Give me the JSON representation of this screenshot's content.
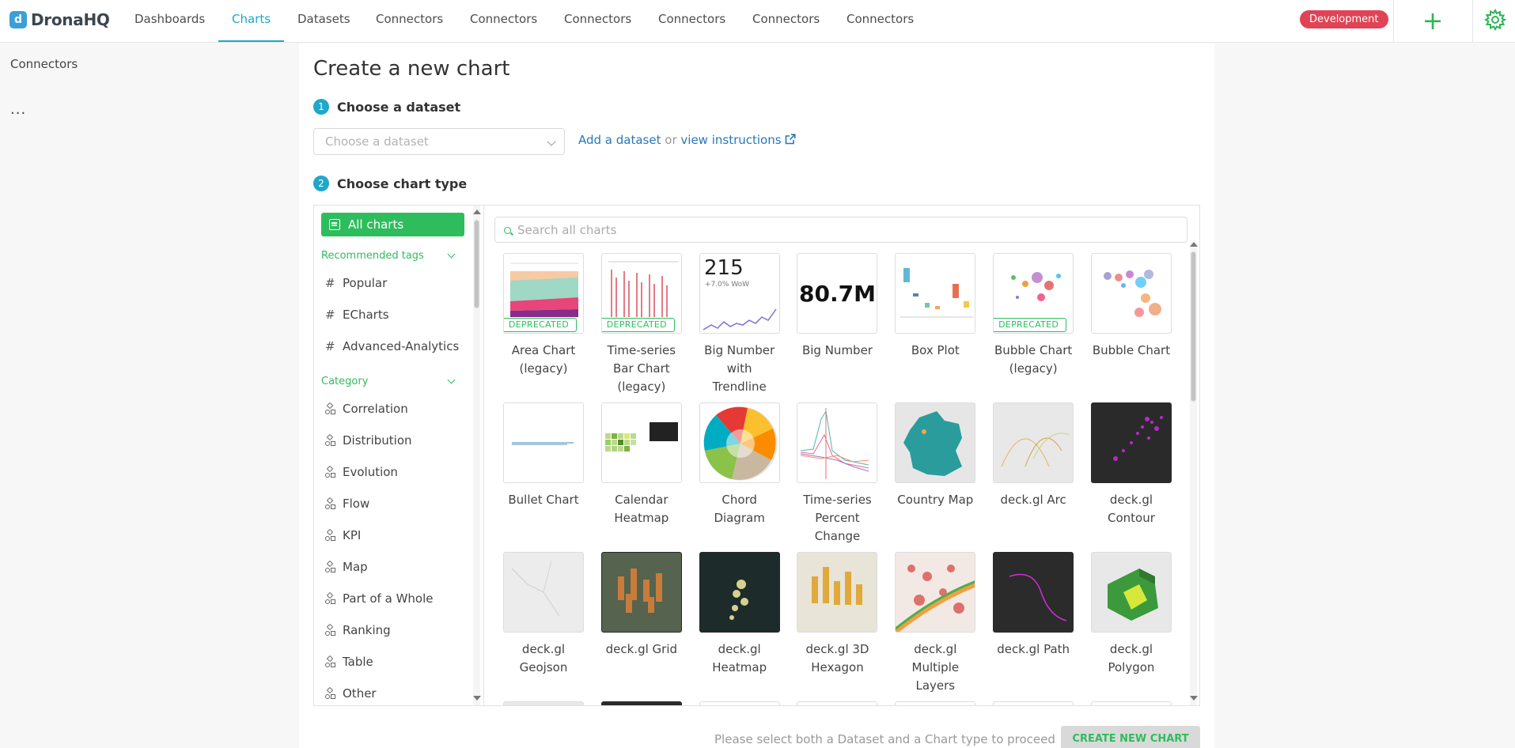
{
  "app": {
    "logo_text": "DronaHQ"
  },
  "nav": {
    "items": [
      {
        "label": "Dashboards"
      },
      {
        "label": "Charts"
      },
      {
        "label": "Datasets"
      },
      {
        "label": "Connectors"
      },
      {
        "label": "Connectors"
      },
      {
        "label": "Connectors"
      },
      {
        "label": "Connectors"
      },
      {
        "label": "Connectors"
      },
      {
        "label": "Connectors"
      }
    ],
    "active_index": 1,
    "environment_badge": "Development",
    "add_icon": "plus-icon",
    "settings_icon": "gear-icon"
  },
  "left_sidebar": {
    "title": "Connectors",
    "more": "..."
  },
  "page": {
    "title": "Create a new chart",
    "step1": {
      "number": "1",
      "label": "Choose a dataset"
    },
    "dataset_select": {
      "placeholder": "Choose a dataset"
    },
    "add_dataset_link": "Add a dataset",
    "or_text": "or",
    "view_instructions_link": "view instructions",
    "step2": {
      "number": "2",
      "label": "Choose chart type"
    }
  },
  "filters": {
    "all_charts": "All charts",
    "recommended_tags_heading": "Recommended tags",
    "tags": [
      "Popular",
      "ECharts",
      "Advanced-Analytics"
    ],
    "category_heading": "Category",
    "categories": [
      "Correlation",
      "Distribution",
      "Evolution",
      "Flow",
      "KPI",
      "Map",
      "Part of a Whole",
      "Ranking",
      "Table",
      "Other"
    ]
  },
  "search": {
    "placeholder": "Search all charts"
  },
  "charts": [
    {
      "label": "Area Chart (legacy)",
      "deprecated": true
    },
    {
      "label": "Time-series Bar Chart (legacy)",
      "deprecated": true
    },
    {
      "label": "Big Number with Trendline",
      "deprecated": false,
      "thumb_value": "215",
      "thumb_sub": "+7.0% WoW"
    },
    {
      "label": "Big Number",
      "deprecated": false,
      "thumb_value": "80.7M"
    },
    {
      "label": "Box Plot",
      "deprecated": false
    },
    {
      "label": "Bubble Chart (legacy)",
      "deprecated": true
    },
    {
      "label": "Bubble Chart",
      "deprecated": false
    },
    {
      "label": "Bullet Chart",
      "deprecated": false
    },
    {
      "label": "Calendar Heatmap",
      "deprecated": false
    },
    {
      "label": "Chord Diagram",
      "deprecated": false
    },
    {
      "label": "Time-series Percent Change",
      "deprecated": false
    },
    {
      "label": "Country Map",
      "deprecated": false
    },
    {
      "label": "deck.gl Arc",
      "deprecated": false
    },
    {
      "label": "deck.gl Contour",
      "deprecated": false
    },
    {
      "label": "deck.gl Geojson",
      "deprecated": false
    },
    {
      "label": "deck.gl Grid",
      "deprecated": false
    },
    {
      "label": "deck.gl Heatmap",
      "deprecated": false
    },
    {
      "label": "deck.gl 3D Hexagon",
      "deprecated": false
    },
    {
      "label": "deck.gl Multiple Layers",
      "deprecated": false
    },
    {
      "label": "deck.gl Path",
      "deprecated": false
    },
    {
      "label": "deck.gl Polygon",
      "deprecated": false
    }
  ],
  "deprecated_label": "DEPRECATED",
  "footer": {
    "hint": "Please select both a Dataset and a Chart type to proceed",
    "create_button": "CREATE NEW CHART"
  },
  "colors": {
    "accent": "#20a7c9",
    "green": "#2ebd5c",
    "badge_red": "#e04355"
  }
}
